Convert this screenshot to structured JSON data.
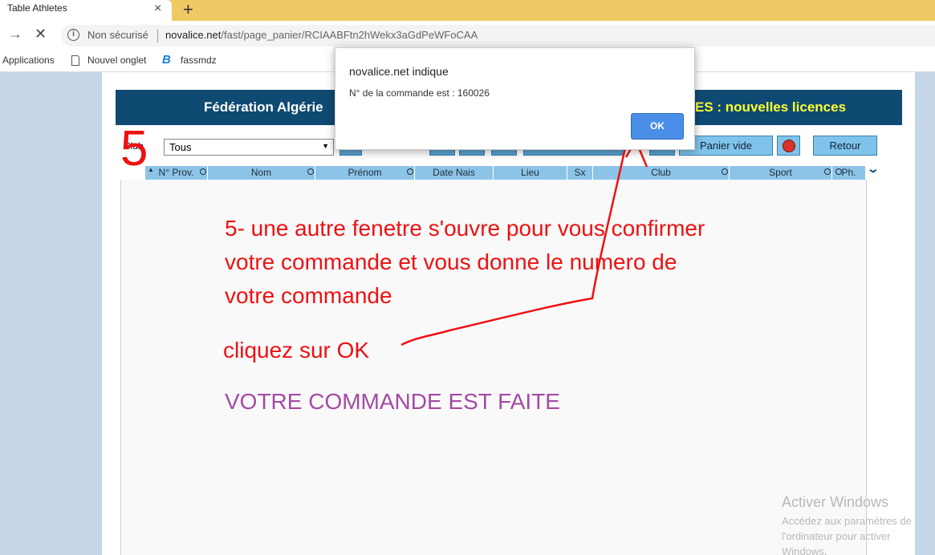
{
  "browser": {
    "tab_title": "Table Athletes",
    "tab_close": "×",
    "new_tab": "+",
    "back": "→",
    "reload": "✕",
    "security_label": "Non sécurisé",
    "url_domain": "novalice.net",
    "url_path": "/fast/page_panier/RCIAABFtn2hWekx3aGdPeWFoCAA"
  },
  "bookmarks": {
    "apps": "Applications",
    "new_tab": "Nouvel onglet",
    "fassmdz": "fassmdz"
  },
  "page": {
    "header_title": "Fédération Algérie",
    "header_subtitle": "ES : nouvelles licences",
    "club_label": "Club",
    "club_value": "Tous",
    "panier_vide": "Panier vide",
    "retour": "Retour",
    "columns": [
      "N° Prov.",
      "Nom",
      "Prénom",
      "Date Nais",
      "Lieu",
      "Sx",
      "Club",
      "Sport",
      "Ph."
    ]
  },
  "dialog": {
    "title": "novalice.net indique",
    "message": "N° de la commande est : 160026",
    "ok": "OK"
  },
  "annotation": {
    "step_number": "5",
    "line1": "5- une autre fenetre s'ouvre pour vous confirmer",
    "line2": "votre commande et vous donne le numero de",
    "line3": "votre commande",
    "click": "cliquez sur OK",
    "done": "VOTRE COMMANDE EST FAITE"
  },
  "watermark": {
    "title": "Activer Windows",
    "sub": "Accédez aux paramètres de l'ordinateur pour activer Windows."
  },
  "colors": {
    "tabstrip": "#f0c965",
    "header": "#0f4a73",
    "header_subtitle": "#ffff33",
    "grid_header": "#8cc4e8",
    "ok_button": "#4a8ee8",
    "annotation_red": "#ee1111",
    "annotation_purple": "#a54aa3"
  }
}
